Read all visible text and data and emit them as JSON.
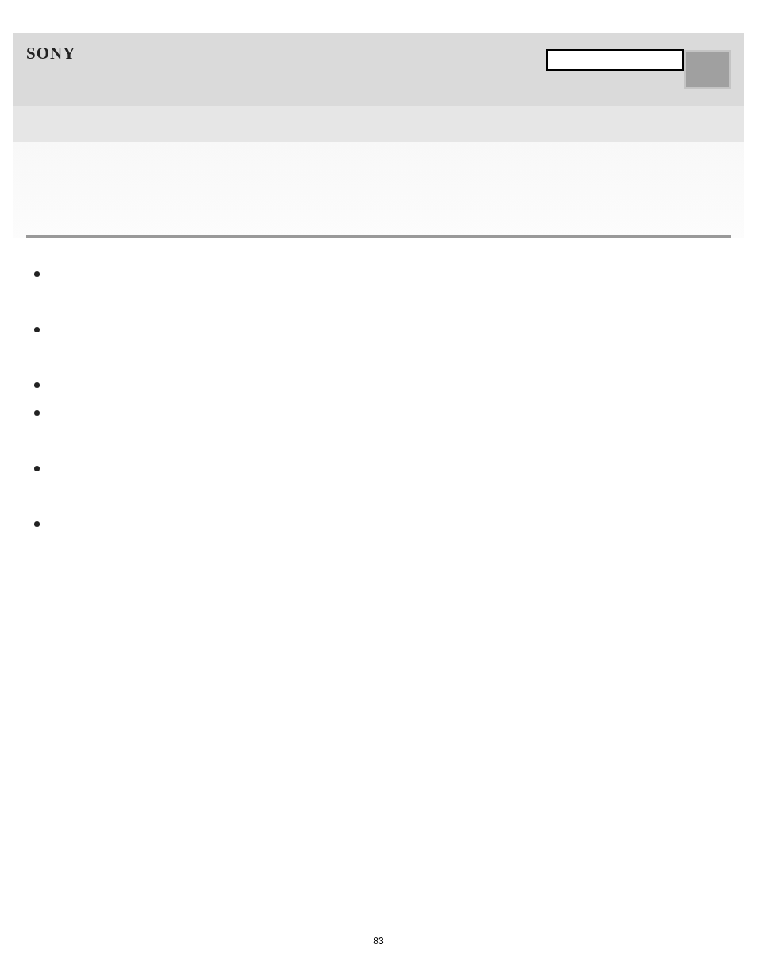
{
  "header": {
    "logo": "SONY"
  },
  "bullets": [
    {
      "kind": "double"
    },
    {
      "kind": "double"
    },
    {
      "kind": "single"
    },
    {
      "kind": "double"
    },
    {
      "kind": "double"
    },
    {
      "kind": "single"
    }
  ],
  "footer": {
    "page_number": "83"
  }
}
